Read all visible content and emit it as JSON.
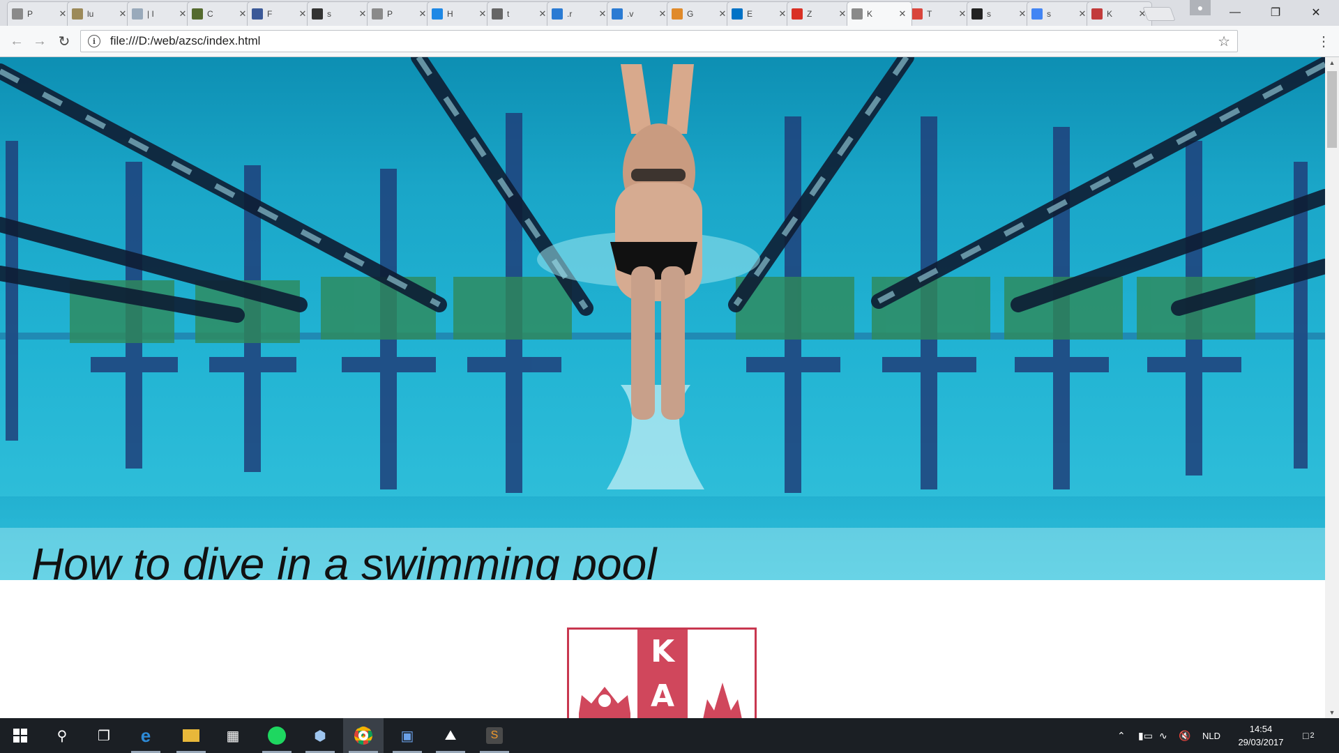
{
  "browser": {
    "tabs": [
      {
        "icon": "document-icon",
        "title": "P",
        "color": "#8a8a8a"
      },
      {
        "icon": "pisa-icon",
        "title": "lu",
        "color": "#9c8a5a"
      },
      {
        "icon": "blank-icon",
        "title": "| I",
        "color": "#9ab"
      },
      {
        "icon": "photo-icon",
        "title": "C",
        "color": "#556b2f"
      },
      {
        "icon": "facebook-icon",
        "title": "F",
        "color": "#3b5998"
      },
      {
        "icon": "codepen-icon",
        "title": "s",
        "color": "#333333"
      },
      {
        "icon": "document-icon",
        "title": "P",
        "color": "#8a8a8a"
      },
      {
        "icon": "c-logo-icon",
        "title": "H",
        "color": "#1e88e5"
      },
      {
        "icon": "c-letter-icon",
        "title": "t",
        "color": "#666666"
      },
      {
        "icon": "wave-icon",
        "title": ".r",
        "color": "#2b7bd3"
      },
      {
        "icon": "wave-icon",
        "title": ".v",
        "color": "#2b7bd3"
      },
      {
        "icon": "gitbook-icon",
        "title": "G",
        "color": "#e08a2a"
      },
      {
        "icon": "outlook-icon",
        "title": "E",
        "color": "#0072c6"
      },
      {
        "icon": "gmail-icon",
        "title": "Z",
        "color": "#d93025"
      },
      {
        "icon": "document-icon",
        "title": "K",
        "color": "#8a8a8a"
      },
      {
        "icon": "tool-icon",
        "title": "T",
        "color": "#d9453c"
      },
      {
        "icon": "github-icon",
        "title": "s",
        "color": "#222222"
      },
      {
        "icon": "google-icon",
        "title": "s",
        "color": "#4285f4"
      },
      {
        "icon": "calendar-icon",
        "title": "K",
        "color": "#c23b3b"
      }
    ],
    "url": "file:///D:/web/azsc/index.html"
  },
  "page": {
    "hero_title": "How to dive in a swimming pool",
    "logo": {
      "top_letter": "K",
      "bottom_letter": "A",
      "color": "#d0475c"
    }
  },
  "taskbar": {
    "apps": [
      "windows-start-icon",
      "search-icon",
      "task-view-icon",
      "edge-icon",
      "file-explorer-icon",
      "store-icon",
      "spotify-icon",
      "virtualbox-icon",
      "chrome-icon",
      "network-app-icon",
      "photos-icon",
      "sublime-icon"
    ],
    "language": "NLD",
    "time": "14:54",
    "date": "29/03/2017",
    "notification_count": "2"
  }
}
